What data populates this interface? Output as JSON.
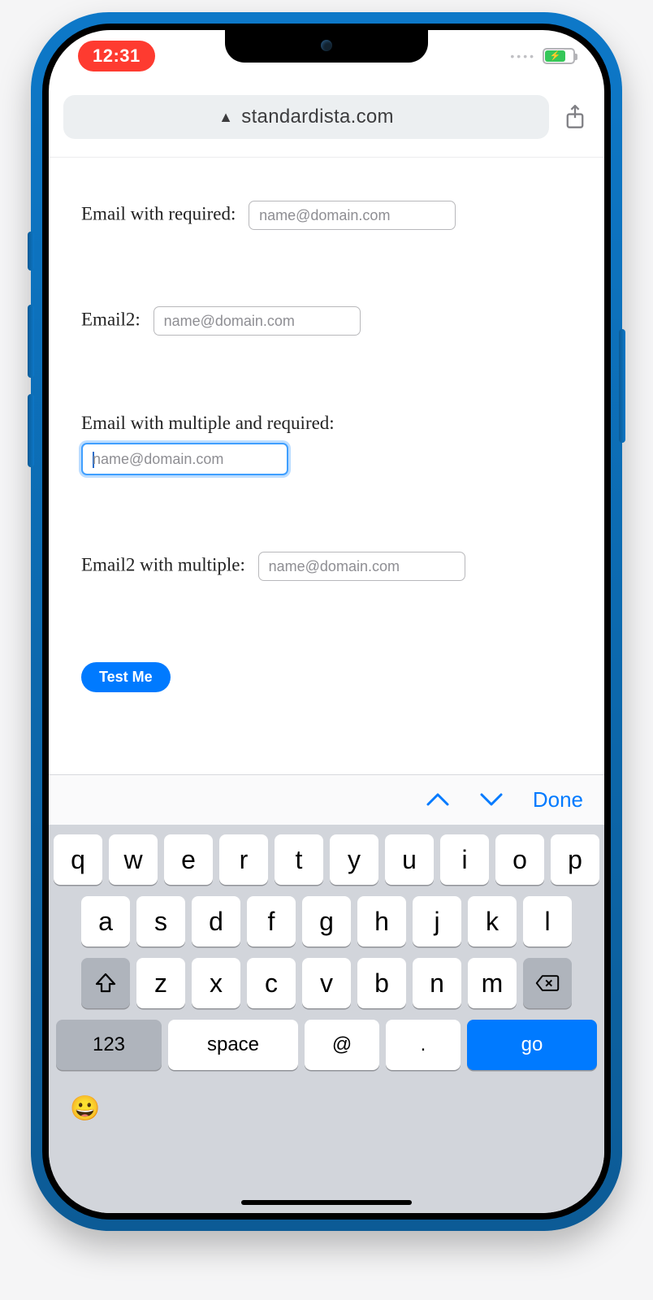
{
  "status": {
    "time": "12:31",
    "cellular_dots": "••••",
    "battery_charging": true
  },
  "url_bar": {
    "domain": "standardista.com"
  },
  "form": {
    "fields": [
      {
        "label": "Email with required:",
        "placeholder": "name@domain.com",
        "value": "",
        "focused": false,
        "stacked": false
      },
      {
        "label": "Email2:",
        "placeholder": "name@domain.com",
        "value": "",
        "focused": false,
        "stacked": false
      },
      {
        "label": "Email with multiple and required:",
        "placeholder": "name@domain.com",
        "value": "",
        "focused": true,
        "stacked": true
      },
      {
        "label": "Email2 with multiple:",
        "placeholder": "name@domain.com",
        "value": "",
        "focused": false,
        "stacked": false
      }
    ],
    "submit_label": "Test Me"
  },
  "accessory": {
    "done_label": "Done"
  },
  "keyboard": {
    "row1": [
      "q",
      "w",
      "e",
      "r",
      "t",
      "y",
      "u",
      "i",
      "o",
      "p"
    ],
    "row2": [
      "a",
      "s",
      "d",
      "f",
      "g",
      "h",
      "j",
      "k",
      "l"
    ],
    "row3": [
      "z",
      "x",
      "c",
      "v",
      "b",
      "n",
      "m"
    ],
    "numeric_label": "123",
    "space_label": "space",
    "at_label": "@",
    "dot_label": ".",
    "go_label": "go"
  }
}
